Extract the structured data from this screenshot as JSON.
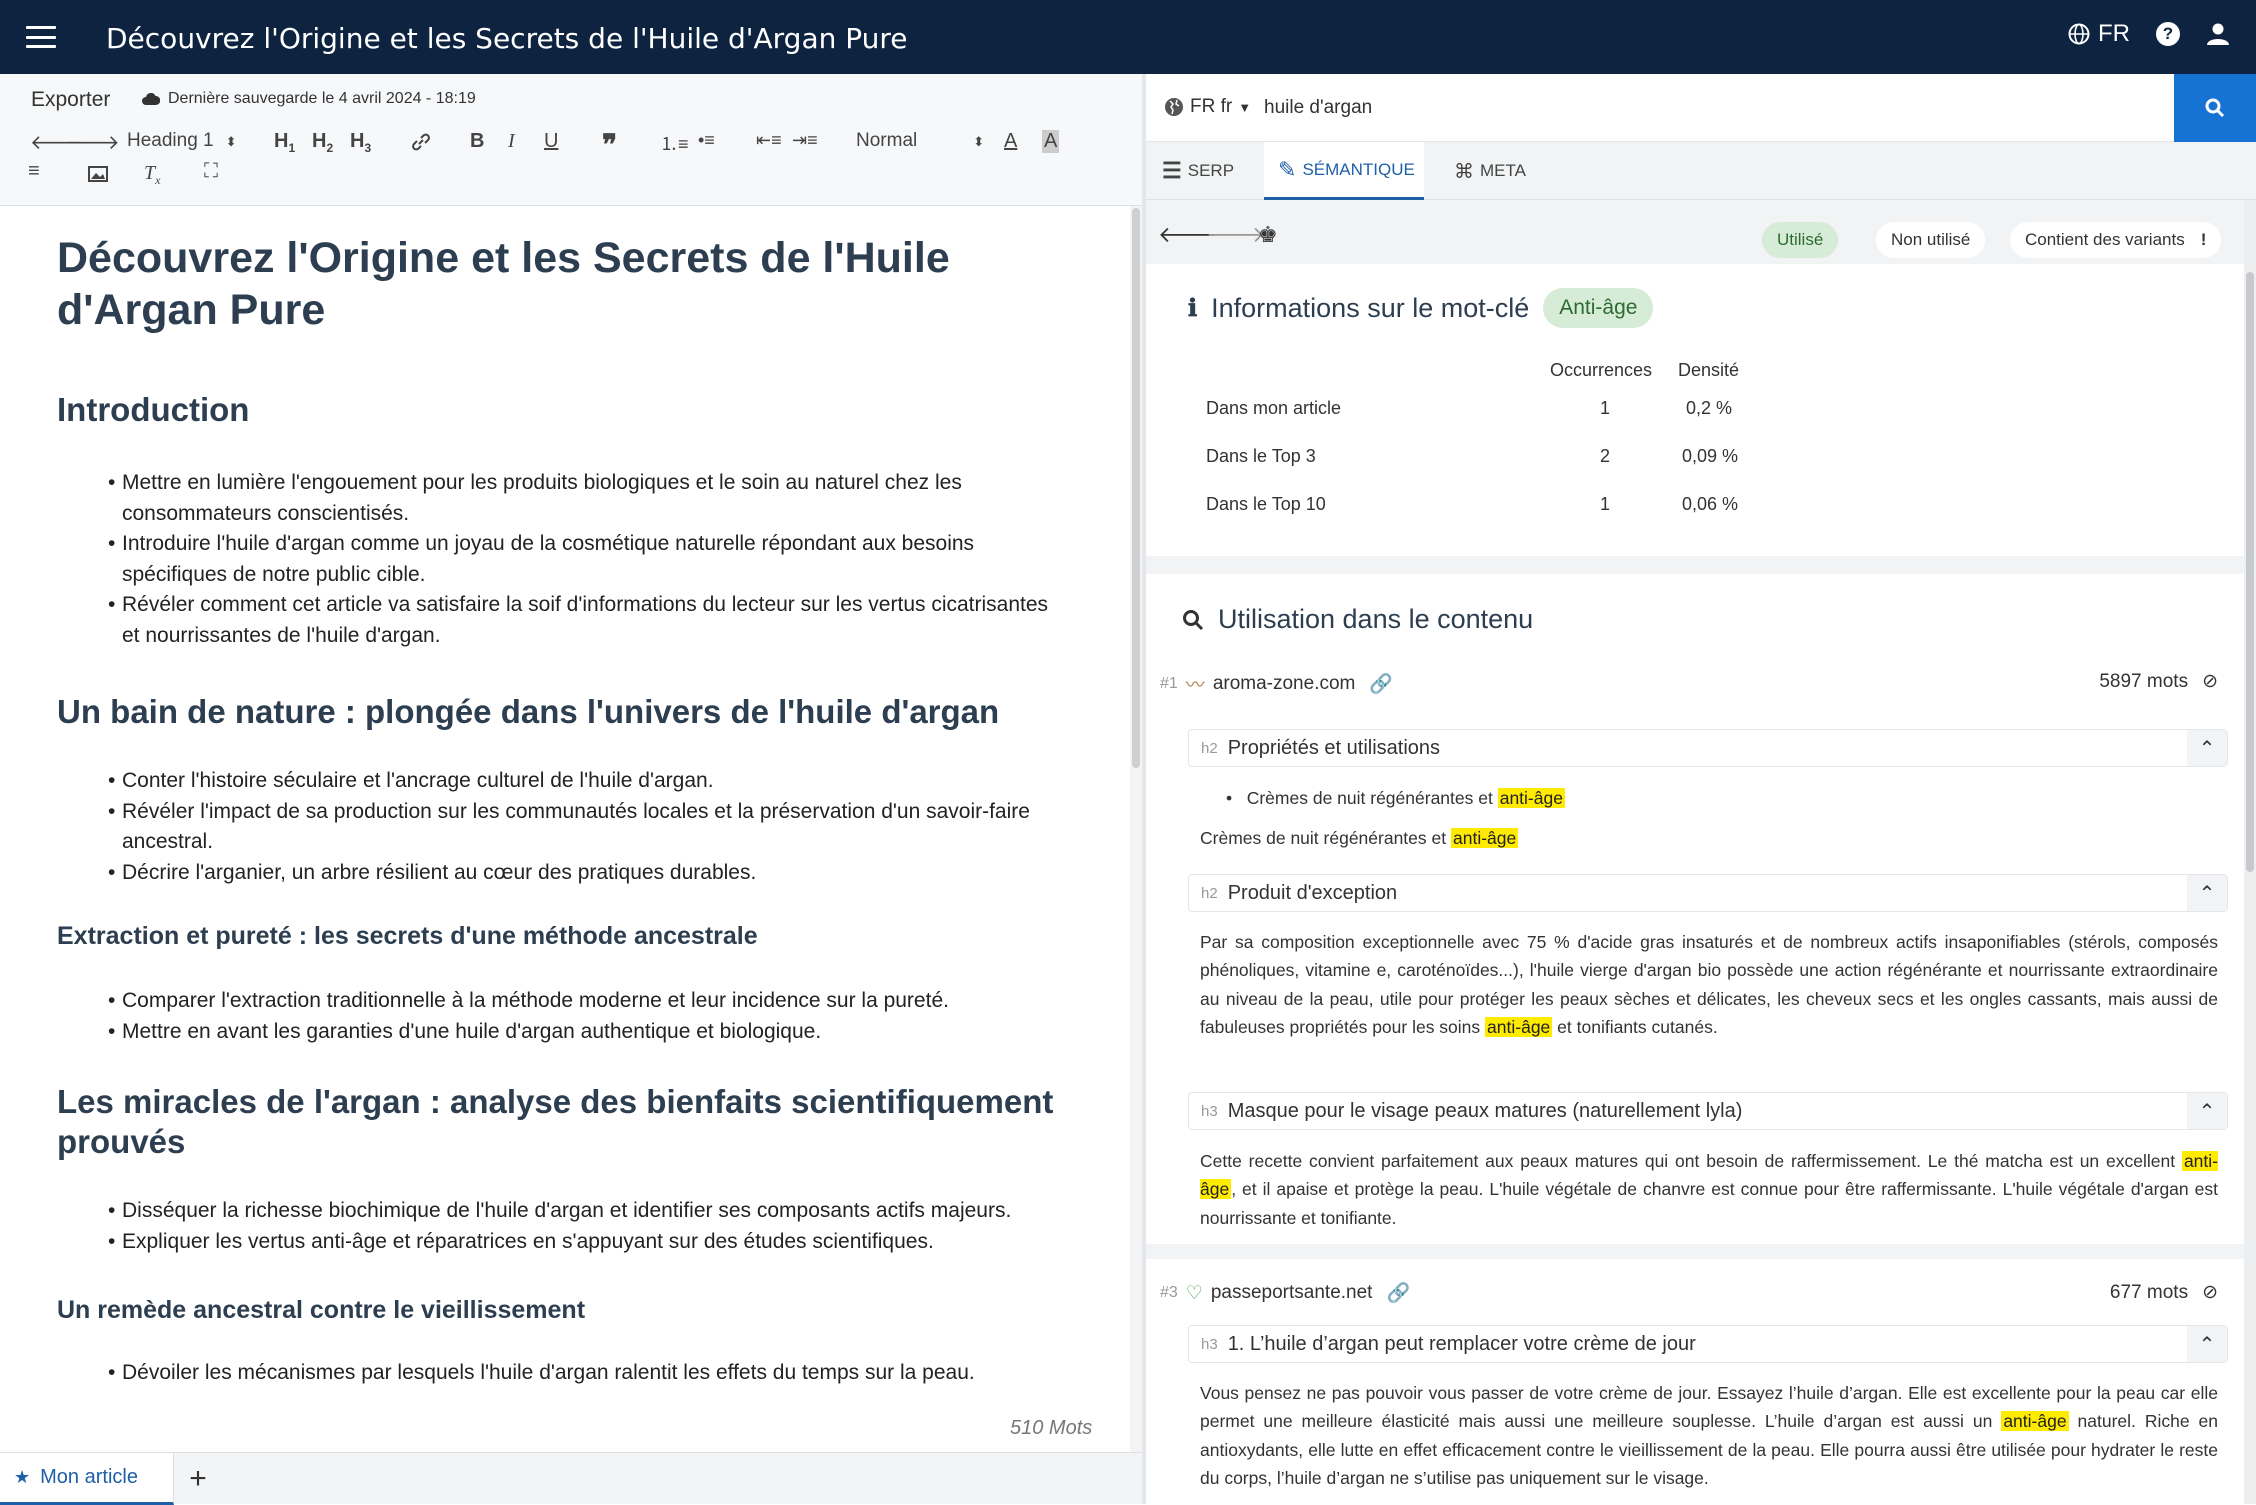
{
  "header": {
    "title": "Découvrez l'Origine et les Secrets de l'Huile d'Argan Pure",
    "lang": "FR"
  },
  "editor_top": {
    "export_label": "Exporter",
    "saved_text": "Dernière sauvegarde le 4 avril 2024 - 18:19",
    "heading_select": "Heading 1",
    "size_select": "Normal"
  },
  "article": {
    "h1": "Découvrez l'Origine et les Secrets de l'Huile d'Argan Pure",
    "s1_h2": "Introduction",
    "s1_items": [
      "Mettre en lumière l'engouement pour les produits biologiques et le soin au naturel chez les consommateurs conscientisés.",
      "Introduire l'huile d'argan comme un joyau de la cosmétique naturelle répondant aux besoins spécifiques de notre public cible.",
      "Révéler comment cet article va satisfaire la soif d'informations du lecteur sur les vertus cicatrisantes et nourrissantes de l'huile d'argan."
    ],
    "s2_h2": "Un bain de nature : plongée dans l'univers de l'huile d'argan",
    "s2_items": [
      "Conter l'histoire séculaire et l'ancrage culturel de l'huile d'argan.",
      "Révéler l'impact de sa production sur les communautés locales et la préservation d'un savoir-faire ancestral.",
      "Décrire l'arganier, un arbre résilient au cœur des pratiques durables."
    ],
    "s3_h3": "Extraction et pureté : les secrets d'une méthode ancestrale",
    "s3_items": [
      "Comparer l'extraction traditionnelle à la méthode moderne et leur incidence sur la pureté.",
      "Mettre en avant les garanties d'une huile d'argan authentique et biologique."
    ],
    "s4_h2": "Les miracles de l'argan : analyse des bienfaits scientifiquement prouvés",
    "s4_items": [
      "Disséquer la richesse biochimique de l'huile d'argan et identifier ses composants actifs majeurs.",
      "Expliquer les vertus anti-âge et réparatrices en s'appuyant sur des études scientifiques."
    ],
    "s5_h3": "Un remède ancestral contre le vieillissement",
    "s5_items": [
      "Dévoiler les mécanismes par lesquels l'huile d'argan ralentit les effets du temps sur la peau."
    ],
    "word_count": "510 Mots"
  },
  "bottom_tabs": {
    "tab1": "Mon article",
    "add": "+"
  },
  "search": {
    "lang_label": "FR fr",
    "query": "huile d'argan"
  },
  "tabs": {
    "serp": "SERP",
    "semantique": "SÉMANTIQUE",
    "meta": "META"
  },
  "filters": {
    "used": "Utilisé",
    "unused": "Non utilisé",
    "variants": "Contient des variants"
  },
  "keyword_info": {
    "title": "Informations sur le mot-clé",
    "keyword": "Anti-âge",
    "col_occ": "Occurrences",
    "col_dens": "Densité",
    "rows": [
      {
        "label": "Dans mon article",
        "occ": "1",
        "dens": "0,2 %"
      },
      {
        "label": "Dans le Top 3",
        "occ": "2",
        "dens": "0,09 %"
      },
      {
        "label": "Dans le Top 10",
        "occ": "1",
        "dens": "0,06 %"
      }
    ]
  },
  "usage": {
    "title": "Utilisation dans le contenu",
    "src1": {
      "rank": "#1",
      "domain": "aroma-zone.com",
      "words": "5897 mots",
      "h1_tag": "h2",
      "h1_title": "Propriétés et utilisations",
      "bullet_pre": "Crèmes de nuit régénérantes et",
      "kw": "anti-âge",
      "para1_pre": "Crèmes de nuit régénérantes et",
      "h2_tag": "h2",
      "h2_title": "Produit d'exception",
      "para2_pre": "Par sa composition exceptionnelle avec 75 % d'acide gras insaturés et de nombreux actifs insaponifiables (stérols, composés phénoliques, vitamine e, caroténoïdes...), l'huile vierge d'argan bio possède une action régénérante et nourrissante extraordinaire au niveau de la peau, utile pour protéger les peaux sèches et délicates, les cheveux secs et les ongles cassants, mais aussi de fabuleuses propriétés pour les soins",
      "para2_post": "et tonifiants cutanés.",
      "h3_tag": "h3",
      "h3_title": "Masque pour le visage peaux matures (naturellement lyla)",
      "para3_pre": "Cette recette convient parfaitement aux peaux matures qui ont besoin de raffermissement. Le thé matcha est un excellent",
      "para3_post": ", et il apaise et protège la peau. L'huile végétale de chanvre est connue pour être raffermissante. L'huile végétale d'argan est nourrissante et tonifiante."
    },
    "src2": {
      "rank": "#3",
      "domain": "passeportsante.net",
      "words": "677 mots",
      "h1_tag": "h3",
      "h1_title": "1. L’huile d’argan peut remplacer votre crème de jour",
      "para_pre": "Vous pensez ne pas pouvoir vous passer de votre crème de jour. Essayez l’huile d’argan. Elle est excellente pour la peau car elle permet une meilleure élasticité mais aussi une meilleure souplesse. L’huile d’argan est aussi un",
      "para_post": "naturel. Riche en antioxydants, elle lutte en effet efficacement contre le vieillissement de la peau. Elle pourra aussi être utilisée pour hydrater le reste du corps, l’huile d’argan ne s’utilise pas uniquement sur le visage."
    }
  },
  "colors": {
    "header_bg": "#0d2340",
    "accent": "#1673d4",
    "used_pill": "#d6ecd7",
    "highlight": "#ffeb00"
  }
}
